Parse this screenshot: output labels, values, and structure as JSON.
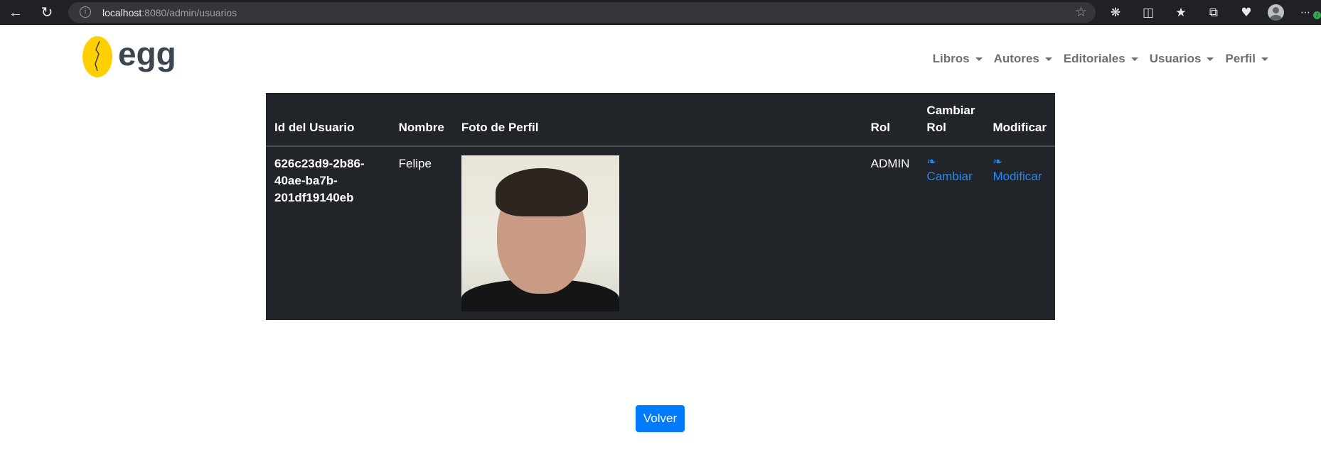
{
  "browser": {
    "url_host": "localhost",
    "url_path": ":8080/admin/usuarios"
  },
  "brand": {
    "logo_text": "egg"
  },
  "navbar": {
    "items": [
      {
        "label": "Libros"
      },
      {
        "label": "Autores"
      },
      {
        "label": "Editoriales"
      },
      {
        "label": "Usuarios"
      },
      {
        "label": "Perfil"
      }
    ]
  },
  "table": {
    "headers": {
      "id": "Id del Usuario",
      "nombre": "Nombre",
      "foto": "Foto de Perfil",
      "rol": "Rol",
      "cambiar_rol_1": "Cambiar",
      "cambiar_rol_2": "Rol",
      "modificar": "Modificar"
    },
    "rows": [
      {
        "id_1": "626c23d9-2b86-",
        "id_2": "40ae-ba7b-",
        "id_3": "201df19140eb",
        "nombre": "Felipe",
        "rol": "ADMIN",
        "cambiar_link": "Cambiar",
        "modificar_link": "Modificar"
      }
    ]
  },
  "footer": {
    "volver_label": "Volver"
  },
  "colors": {
    "accent": "#007bff",
    "table_bg": "#212529",
    "logo_yellow": "#ffd000"
  },
  "icons": {
    "leaf": "leaf-icon"
  }
}
